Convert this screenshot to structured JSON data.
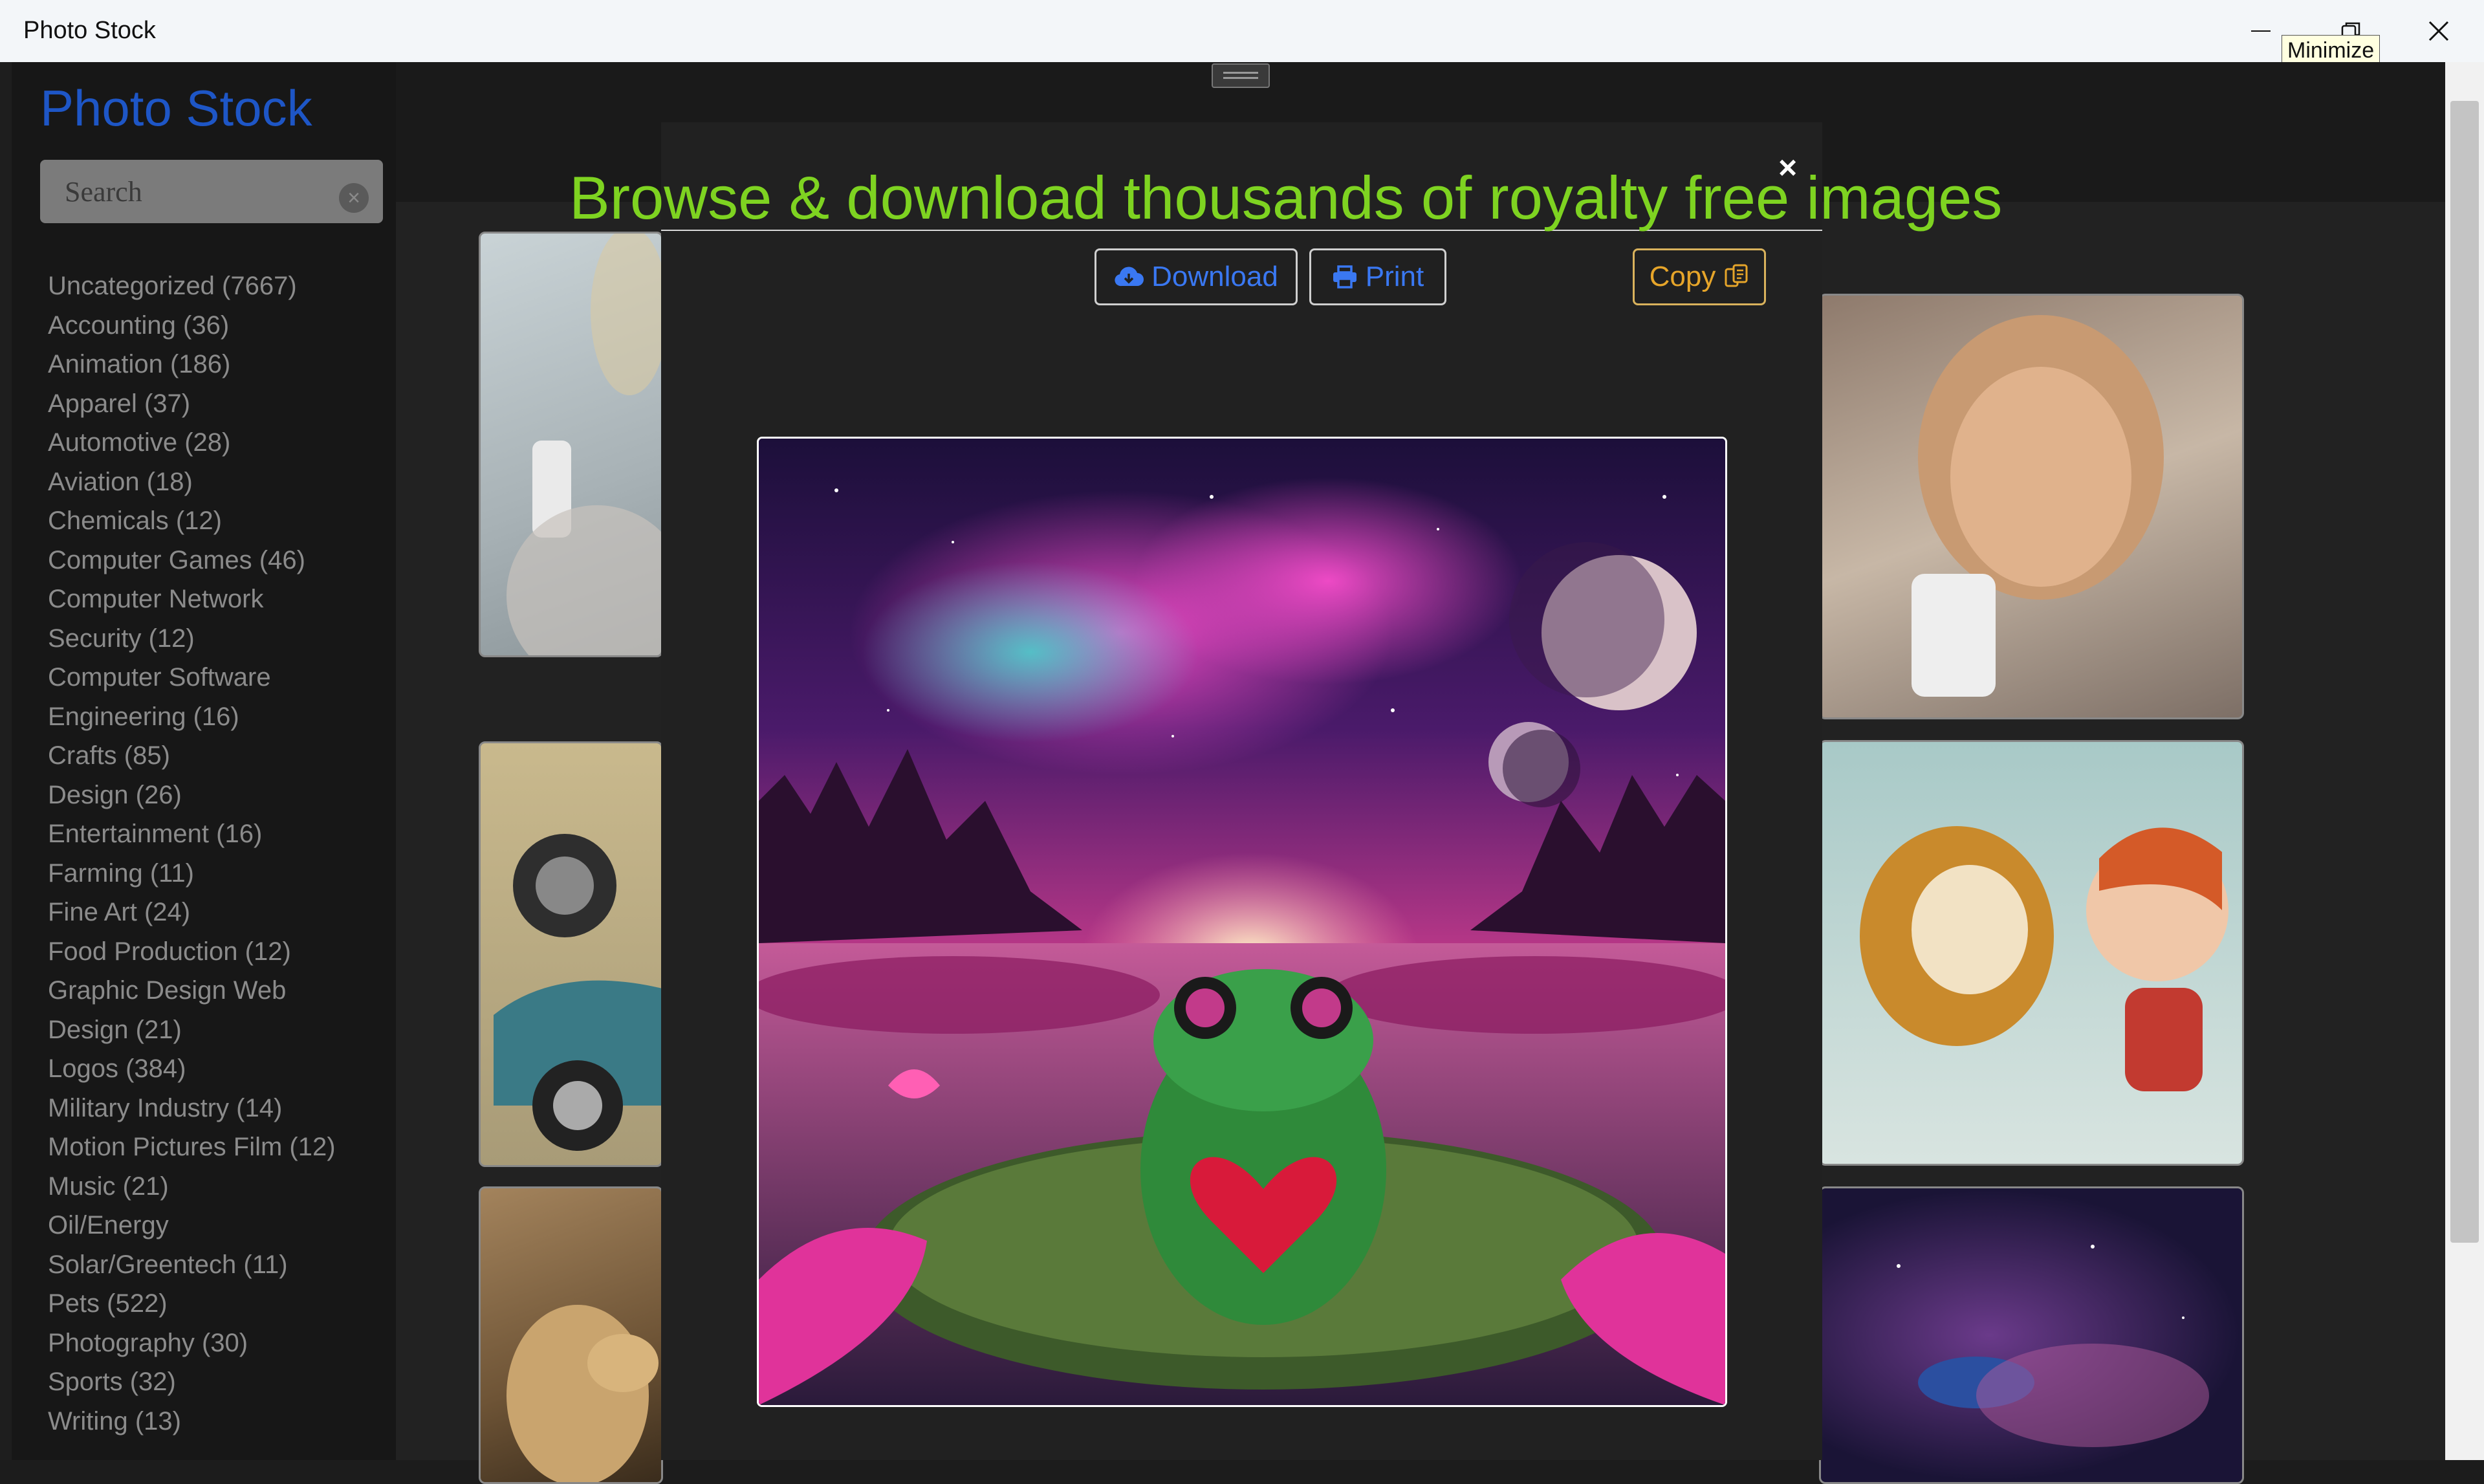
{
  "window": {
    "title": "Photo Stock",
    "tooltip": "Minimize"
  },
  "sidebar": {
    "brand": "Photo Stock",
    "search_placeholder": "Search",
    "categories": [
      "Uncategorized (7667)",
      "Accounting (36)",
      "Animation (186)",
      "Apparel (37)",
      "Automotive (28)",
      "Aviation (18)",
      "Chemicals (12)",
      "Computer Games (46)",
      "Computer Network",
      "Security (12)",
      "Computer Software",
      "Engineering (16)",
      "Crafts (85)",
      "Design (26)",
      "Entertainment (16)",
      "Farming (11)",
      "Fine Art (24)",
      "Food Production (12)",
      "Graphic Design Web",
      "Design (21)",
      "Logos (384)",
      "Military Industry (14)",
      "Motion Pictures Film (12)",
      "Music (21)",
      "Oil/Energy",
      "Solar/Greentech (11)",
      "Pets (522)",
      "Photography (30)",
      "Sports (32)",
      "Writing (13)"
    ]
  },
  "header": {
    "headline": "Browse & download thousands of royalty free images"
  },
  "modal": {
    "download_label": "Download",
    "print_label": "Print",
    "copy_label": "Copy",
    "close_symbol": "×"
  },
  "colors": {
    "brand": "#1e56c6",
    "headline": "#7ed321",
    "button_text": "#3a78f2",
    "copy_text": "#e6a52a"
  }
}
